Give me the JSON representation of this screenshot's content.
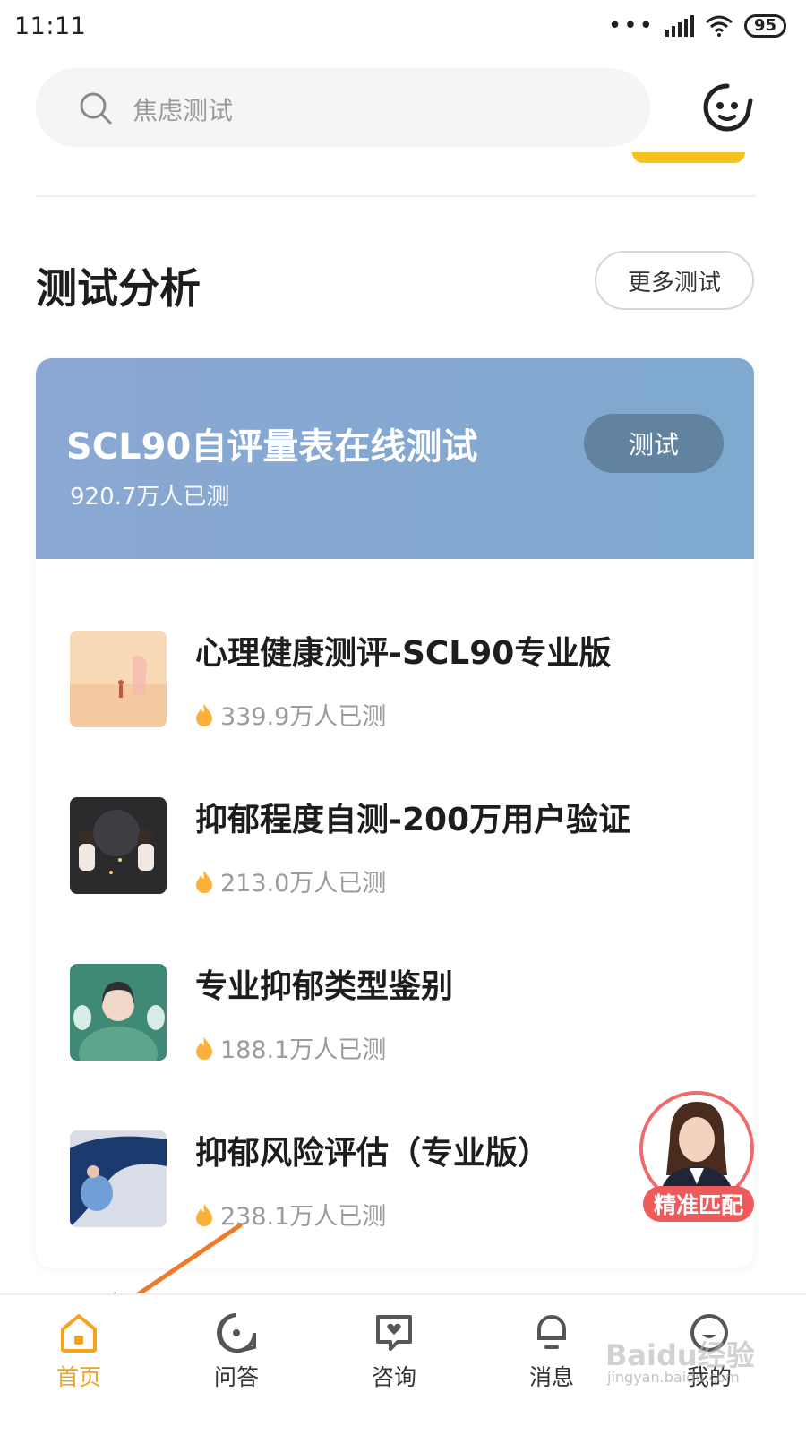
{
  "status_bar": {
    "time": "11:11",
    "battery": "95"
  },
  "search": {
    "placeholder": "焦虑测试"
  },
  "section": {
    "title": "测试分析",
    "more_label": "更多测试"
  },
  "featured": {
    "title": "SCL90自评量表在线测试",
    "count": "920.7万人已测",
    "button_label": "测试"
  },
  "tests": [
    {
      "title": "心理健康测评-SCL90专业版",
      "count": "339.9万人已测"
    },
    {
      "title": "抑郁程度自测-200万用户验证",
      "count": "213.0万人已测"
    },
    {
      "title": "专业抑郁类型鉴别",
      "count": "188.1万人已测"
    },
    {
      "title": "抑郁风险评估（专业版）",
      "count": "238.1万人已测"
    }
  ],
  "match": {
    "label": "精准匹配"
  },
  "tabs": [
    {
      "label": "首页",
      "icon": "home-icon"
    },
    {
      "label": "问答",
      "icon": "qa-icon"
    },
    {
      "label": "咨询",
      "icon": "consult-icon"
    },
    {
      "label": "消息",
      "icon": "message-icon"
    },
    {
      "label": "我的",
      "icon": "profile-icon"
    }
  ],
  "watermark": {
    "text": "Baidu经验",
    "sub": "jingyan.baidu.com"
  },
  "colors": {
    "accent": "#f4a31a",
    "banner": "#7fa9cf",
    "banner_button": "#62839f",
    "match": "#ee5a5a"
  }
}
